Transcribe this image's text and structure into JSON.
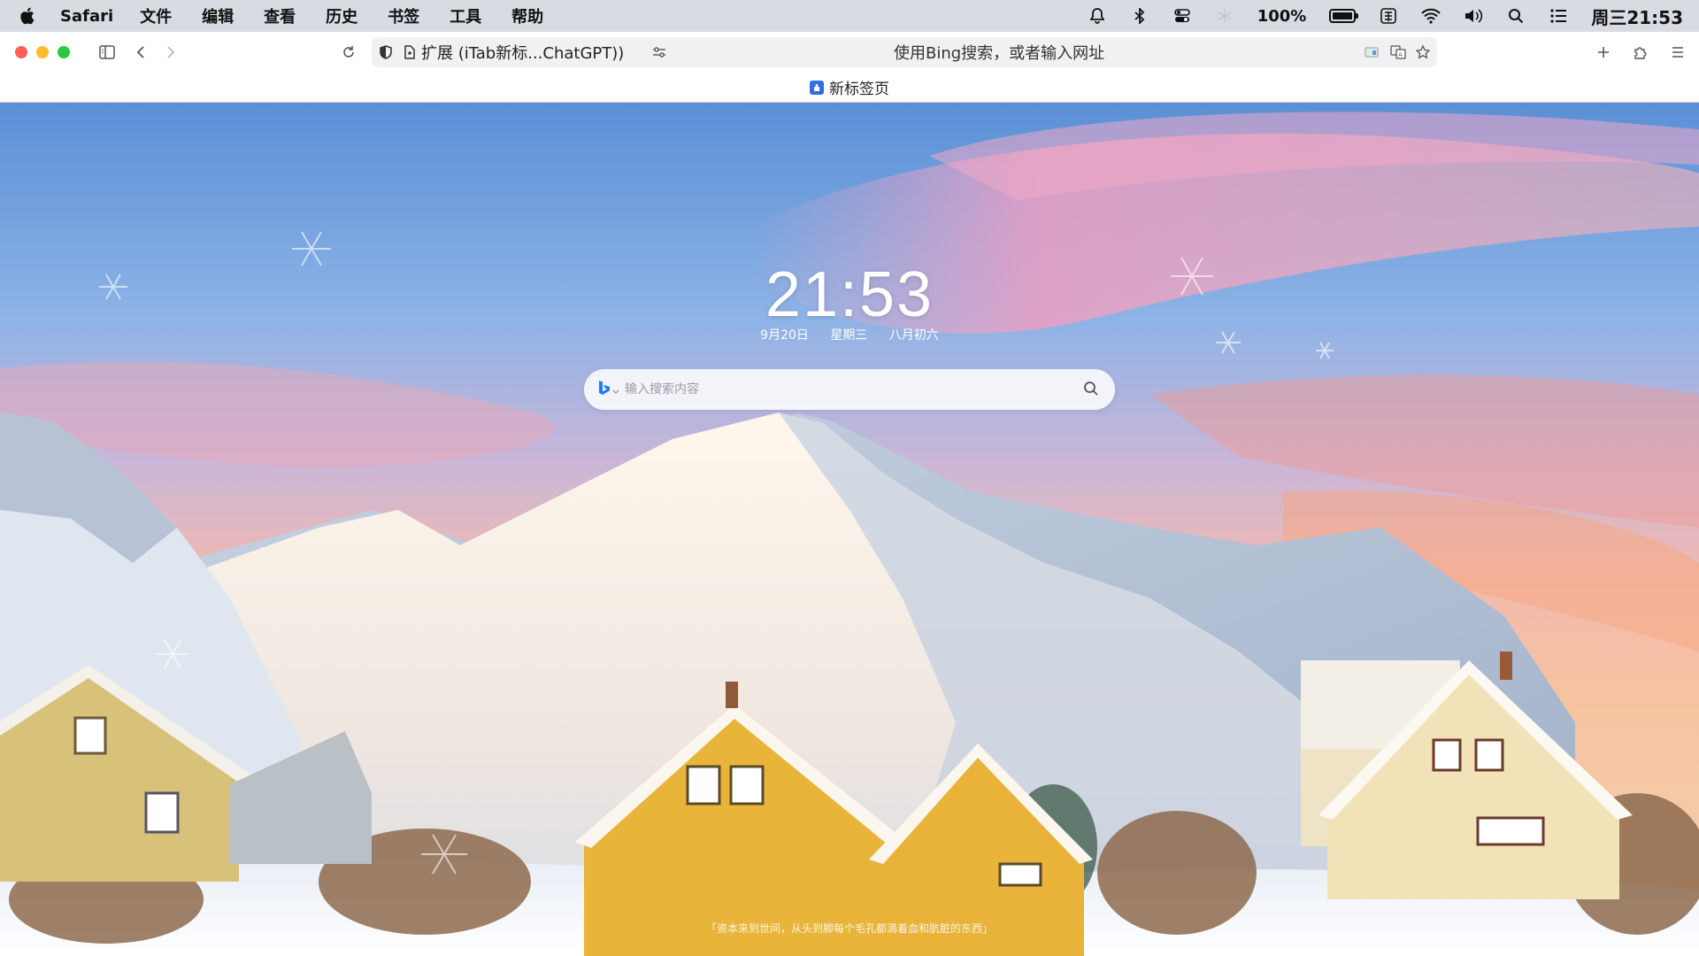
{
  "menubar": {
    "app_name": "Safari",
    "items": [
      "文件",
      "编辑",
      "查看",
      "历史",
      "书签",
      "工具",
      "帮助"
    ],
    "battery_text": "100%",
    "battery_level": 1.0,
    "clock": "周三21:53"
  },
  "toolbar": {
    "tab_title": "扩展 (iTab新标...ChatGPT))",
    "address_placeholder": "使用Bing搜索，或者输入网址"
  },
  "tabstrip": {
    "tab_label": "新标签页"
  },
  "newtab": {
    "time": "21:53",
    "date": "9月20日",
    "weekday": "星期三",
    "lunar": "八月初六",
    "search_placeholder": "输入搜索内容",
    "search_engine": "bing-icon",
    "quote": "「资本来到世间，从头到脚每个毛孔都滴着血和肮脏的东西」"
  },
  "colors": {
    "menubar_bg": "#d9dbe2",
    "close": "#ff5f57",
    "minimize": "#febc2e",
    "zoom": "#28c840",
    "bing_blue": "#1f7cf5"
  }
}
